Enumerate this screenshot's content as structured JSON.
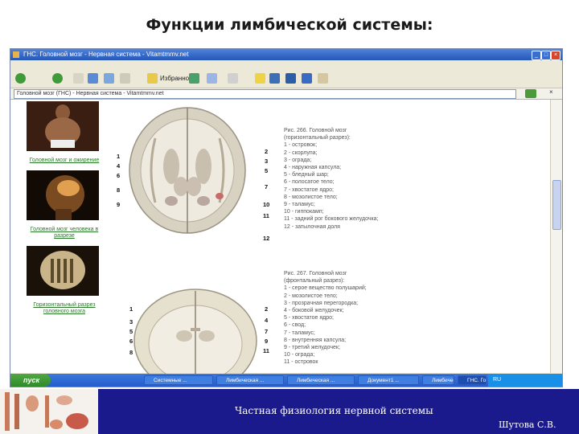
{
  "slide": {
    "title": "Функции лимбической системы:",
    "footer_text": "Частная физиология нервной системы",
    "footer_author": "Шутова С.В."
  },
  "browser": {
    "window_title": "ГНС. Головной мозг - Нервная система - Vitamtmmv.net",
    "toolbar_favorites_label": "Избранное",
    "address": "Головной мозг (ГНС) - Нервная система - Vitamtmmv.net",
    "close_glyph": "×"
  },
  "left_panel": {
    "items": [
      {
        "caption": "Головной мозг и ожирение",
        "image": "obese-man-photo"
      },
      {
        "caption": "Головной мозг человека в разрезе",
        "image": "head-profile-photo"
      },
      {
        "caption": "Горизонтальный разрез головного мозга",
        "image": "brain-slice-photo"
      }
    ]
  },
  "figure1": {
    "caption_lines": [
      "Рис. 266. Головной мозг",
      "(горизонтальный разрез):",
      "1 - островок;",
      "2 - скорлупа;",
      "3 - ограда;",
      "4 - наружная капсула;",
      "5 - бледный шар;",
      "6 - полосатое тело;",
      "7 - хвостатое ядро;",
      "8 - мозолистое тело;",
      "9 - таламус;",
      "10 - гиппокамп;",
      "11 - задний рог бокового желудочка;",
      "12 - затылочная доля"
    ],
    "left_labels": [
      "1",
      "4",
      "6",
      "8",
      "9"
    ],
    "right_labels": [
      "2",
      "3",
      "5",
      "7",
      "10",
      "11",
      "12"
    ]
  },
  "figure2": {
    "caption_lines": [
      "Рис. 267. Головной мозг",
      "(фронтальный разрез):",
      "1 - серое вещество полушарий;",
      "2 - мозолистое тело;",
      "3 - прозрачная перегородка;",
      "4 - боковой желудочек;",
      "5 - хвостатое ядро;",
      "6 - свод;",
      "7 - таламус;",
      "8 - внутренняя капсула;",
      "9 - третий желудочек;",
      "10 - ограда;",
      "11 - островок"
    ],
    "left_labels": [
      "1",
      "3",
      "5",
      "6",
      "8"
    ],
    "right_labels": [
      "2",
      "4",
      "7",
      "9",
      "11"
    ]
  },
  "taskbar": {
    "start_label": "пуск",
    "items": [
      "Системные ...",
      "Лимбическая ...",
      "Лимбическая ...",
      "Документ1 ...",
      "Лимбическая ...",
      "ГНС. Головной ..."
    ],
    "tray_time": "RU"
  },
  "colors": {
    "footer_band": "#1a1a8c",
    "titlebar": "#2457b8",
    "caption_link": "#2a7a2a"
  }
}
